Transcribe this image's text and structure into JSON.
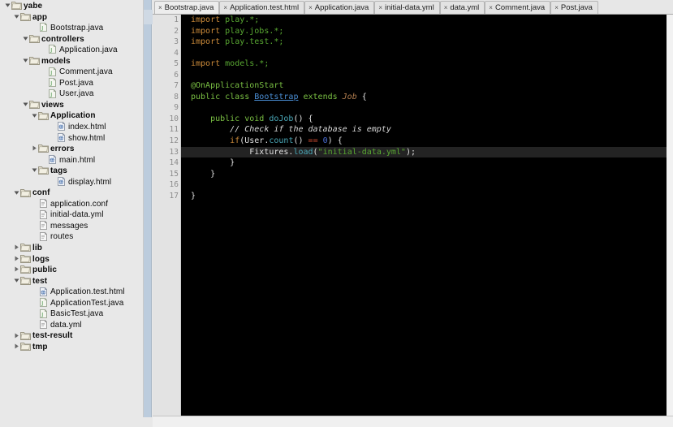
{
  "sidebar": {
    "name": "project-tree",
    "items": [
      {
        "label": "yabe",
        "depth": 0,
        "type": "folder",
        "arrow": "down",
        "bold": true
      },
      {
        "label": "app",
        "depth": 1,
        "type": "folder",
        "arrow": "down",
        "bold": true
      },
      {
        "label": "Bootstrap.java",
        "depth": 3,
        "type": "java",
        "arrow": "none",
        "bold": false
      },
      {
        "label": "controllers",
        "depth": 2,
        "type": "folder",
        "arrow": "down",
        "bold": true
      },
      {
        "label": "Application.java",
        "depth": 4,
        "type": "java",
        "arrow": "none",
        "bold": false
      },
      {
        "label": "models",
        "depth": 2,
        "type": "folder",
        "arrow": "down",
        "bold": true
      },
      {
        "label": "Comment.java",
        "depth": 4,
        "type": "java",
        "arrow": "none",
        "bold": false
      },
      {
        "label": "Post.java",
        "depth": 4,
        "type": "java",
        "arrow": "none",
        "bold": false
      },
      {
        "label": "User.java",
        "depth": 4,
        "type": "java",
        "arrow": "none",
        "bold": false
      },
      {
        "label": "views",
        "depth": 2,
        "type": "folder",
        "arrow": "down",
        "bold": true
      },
      {
        "label": "Application",
        "depth": 3,
        "type": "folder",
        "arrow": "down",
        "bold": true
      },
      {
        "label": "index.html",
        "depth": 5,
        "type": "html",
        "arrow": "none",
        "bold": false
      },
      {
        "label": "show.html",
        "depth": 5,
        "type": "html",
        "arrow": "none",
        "bold": false
      },
      {
        "label": "errors",
        "depth": 3,
        "type": "folder",
        "arrow": "right",
        "bold": true
      },
      {
        "label": "main.html",
        "depth": 4,
        "type": "html",
        "arrow": "none",
        "bold": false
      },
      {
        "label": "tags",
        "depth": 3,
        "type": "folder",
        "arrow": "down",
        "bold": true
      },
      {
        "label": "display.html",
        "depth": 5,
        "type": "html",
        "arrow": "none",
        "bold": false
      },
      {
        "label": "conf",
        "depth": 1,
        "type": "folder",
        "arrow": "down",
        "bold": true
      },
      {
        "label": "application.conf",
        "depth": 3,
        "type": "text",
        "arrow": "none",
        "bold": false
      },
      {
        "label": "initial-data.yml",
        "depth": 3,
        "type": "text",
        "arrow": "none",
        "bold": false
      },
      {
        "label": "messages",
        "depth": 3,
        "type": "text",
        "arrow": "none",
        "bold": false
      },
      {
        "label": "routes",
        "depth": 3,
        "type": "text",
        "arrow": "none",
        "bold": false
      },
      {
        "label": "lib",
        "depth": 1,
        "type": "folder",
        "arrow": "right",
        "bold": true
      },
      {
        "label": "logs",
        "depth": 1,
        "type": "folder",
        "arrow": "right",
        "bold": true
      },
      {
        "label": "public",
        "depth": 1,
        "type": "folder",
        "arrow": "right",
        "bold": true
      },
      {
        "label": "test",
        "depth": 1,
        "type": "folder",
        "arrow": "down",
        "bold": true
      },
      {
        "label": "Application.test.html",
        "depth": 3,
        "type": "html",
        "arrow": "none",
        "bold": false
      },
      {
        "label": "ApplicationTest.java",
        "depth": 3,
        "type": "java",
        "arrow": "none",
        "bold": false
      },
      {
        "label": "BasicTest.java",
        "depth": 3,
        "type": "java",
        "arrow": "none",
        "bold": false
      },
      {
        "label": "data.yml",
        "depth": 3,
        "type": "text",
        "arrow": "none",
        "bold": false
      },
      {
        "label": "test-result",
        "depth": 1,
        "type": "folder",
        "arrow": "right",
        "bold": true
      },
      {
        "label": "tmp",
        "depth": 1,
        "type": "folder",
        "arrow": "right",
        "bold": true
      }
    ]
  },
  "tabs": {
    "close_glyph": "×",
    "items": [
      {
        "label": "Bootstrap.java",
        "active": true
      },
      {
        "label": "Application.test.html",
        "active": false
      },
      {
        "label": "Application.java",
        "active": false
      },
      {
        "label": "initial-data.yml",
        "active": false
      },
      {
        "label": "data.yml",
        "active": false
      },
      {
        "label": "Comment.java",
        "active": false
      },
      {
        "label": "Post.java",
        "active": false
      }
    ]
  },
  "editor": {
    "language": "java",
    "filename": "Bootstrap.java",
    "highlighted_line": 13,
    "line_count": 17,
    "fold_markers": [
      8,
      10,
      12,
      14,
      15,
      17
    ],
    "line_numbers": [
      "1",
      "2",
      "3",
      "4",
      "5",
      "6",
      "7",
      "8",
      "9",
      "10",
      "11",
      "12",
      "13",
      "14",
      "15",
      "16",
      "17"
    ],
    "lines": [
      {
        "n": 1,
        "text": "import play.*;",
        "tokens": [
          {
            "t": "import ",
            "c": "kw2"
          },
          {
            "t": "play.*;",
            "c": "pkg"
          }
        ]
      },
      {
        "n": 2,
        "text": "import play.jobs.*;",
        "tokens": [
          {
            "t": "import ",
            "c": "kw2"
          },
          {
            "t": "play.jobs.*;",
            "c": "pkg"
          }
        ]
      },
      {
        "n": 3,
        "text": "import play.test.*;",
        "tokens": [
          {
            "t": "import ",
            "c": "kw2"
          },
          {
            "t": "play.test.*;",
            "c": "pkg"
          }
        ]
      },
      {
        "n": 4,
        "text": "",
        "tokens": []
      },
      {
        "n": 5,
        "text": "import models.*;",
        "tokens": [
          {
            "t": "import ",
            "c": "kw2"
          },
          {
            "t": "models.*;",
            "c": "pkg"
          }
        ]
      },
      {
        "n": 6,
        "text": "",
        "tokens": []
      },
      {
        "n": 7,
        "text": "@OnApplicationStart",
        "tokens": [
          {
            "t": "@OnApplicationStart",
            "c": "ann"
          }
        ]
      },
      {
        "n": 8,
        "text": "public class Bootstrap extends Job {",
        "tokens": [
          {
            "t": "public class ",
            "c": "kw"
          },
          {
            "t": "Bootstrap",
            "c": "typ"
          },
          {
            "t": " extends ",
            "c": "kw"
          },
          {
            "t": "Job",
            "c": "ital"
          },
          {
            "t": " {",
            "c": "pln"
          }
        ]
      },
      {
        "n": 9,
        "text": "",
        "tokens": []
      },
      {
        "n": 10,
        "text": "    public void doJob() {",
        "tokens": [
          {
            "t": "    public void ",
            "c": "kw"
          },
          {
            "t": "doJob",
            "c": "mth"
          },
          {
            "t": "() {",
            "c": "pln"
          }
        ]
      },
      {
        "n": 11,
        "text": "        // Check if the database is empty",
        "tokens": [
          {
            "t": "        ",
            "c": "pln"
          },
          {
            "t": "// Check if the database is empty",
            "c": "cmt"
          }
        ]
      },
      {
        "n": 12,
        "text": "        if(User.count() == 0) {",
        "tokens": [
          {
            "t": "        ",
            "c": "pln"
          },
          {
            "t": "if",
            "c": "kw2"
          },
          {
            "t": "(",
            "c": "pln"
          },
          {
            "t": "User",
            "c": "pln"
          },
          {
            "t": ".",
            "c": "pln"
          },
          {
            "t": "count",
            "c": "mth"
          },
          {
            "t": "() ",
            "c": "pln"
          },
          {
            "t": "==",
            "c": "op"
          },
          {
            "t": " ",
            "c": "pln"
          },
          {
            "t": "0",
            "c": "num"
          },
          {
            "t": ") {",
            "c": "pln"
          }
        ]
      },
      {
        "n": 13,
        "text": "            Fixtures.load(\"initial-data.yml\");",
        "tokens": [
          {
            "t": "            ",
            "c": "pln"
          },
          {
            "t": "Fixtures",
            "c": "pln"
          },
          {
            "t": ".",
            "c": "pln"
          },
          {
            "t": "load",
            "c": "mth"
          },
          {
            "t": "(",
            "c": "pln"
          },
          {
            "t": "\"initial-data.yml\"",
            "c": "str"
          },
          {
            "t": ");",
            "c": "pln"
          }
        ]
      },
      {
        "n": 14,
        "text": "        }",
        "tokens": [
          {
            "t": "        }",
            "c": "pln"
          }
        ]
      },
      {
        "n": 15,
        "text": "    }",
        "tokens": [
          {
            "t": "    }",
            "c": "pln"
          }
        ]
      },
      {
        "n": 16,
        "text": "",
        "tokens": []
      },
      {
        "n": 17,
        "text": "}",
        "tokens": [
          {
            "t": "}",
            "c": "pln"
          }
        ]
      }
    ]
  },
  "colors": {
    "editor_background": "#000000",
    "highlight_line": "#232323",
    "keyword": "#7ac043",
    "keyword_control": "#cc8b3a",
    "type": "#4b8fd6",
    "italic_type": "#b07c4e",
    "string": "#59a832",
    "method": "#4aa8b8",
    "number": "#4b6fd6",
    "operator": "#cc4b2f",
    "comment": "#d8d8d8",
    "sidebar_background": "#e8e8e8",
    "gutter_background": "#e3e3e3",
    "scrollbar": "#bcccdd"
  }
}
